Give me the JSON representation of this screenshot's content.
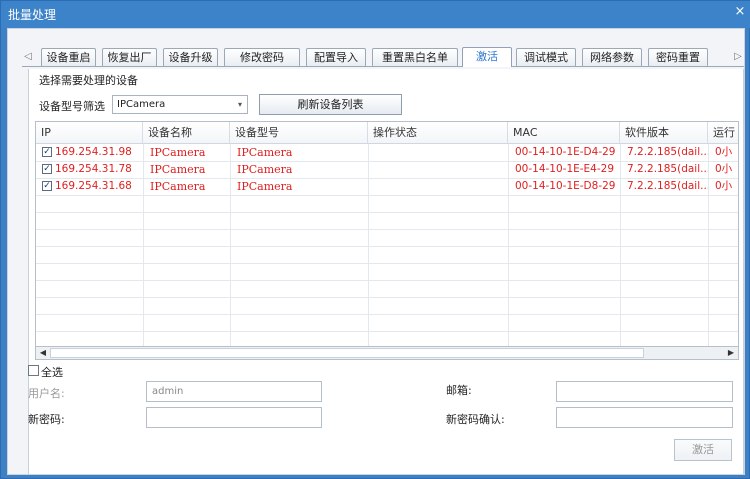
{
  "window": {
    "title": "批量处理",
    "close": "×"
  },
  "tabs": {
    "left_arrow": "◁",
    "right_arrow": "▷",
    "items": [
      {
        "label": "设备重启"
      },
      {
        "label": "恢复出厂"
      },
      {
        "label": "设备升级"
      },
      {
        "label": "修改密码"
      },
      {
        "label": "配置导入"
      },
      {
        "label": "重置黑白名单"
      },
      {
        "label": "激活",
        "active": true
      },
      {
        "label": "调试模式"
      },
      {
        "label": "网络参数"
      },
      {
        "label": "密码重置"
      }
    ]
  },
  "section_title": "选择需要处理的设备",
  "filter": {
    "label": "设备型号筛选",
    "value": "IPCamera",
    "arrow": "▾"
  },
  "refresh_button": "刷新设备列表",
  "grid": {
    "columns": [
      "IP",
      "设备名称",
      "设备型号",
      "操作状态",
      "MAC",
      "软件版本",
      "运行"
    ],
    "rows": [
      {
        "checked": true,
        "ip": "169.254.31.98",
        "name": "IPCamera",
        "model": "IPCamera",
        "status": "",
        "mac": "00-14-10-1E-D4-29",
        "version": "7.2.2.185(dail...",
        "runtime": "0小"
      },
      {
        "checked": true,
        "ip": "169.254.31.78",
        "name": "IPCamera",
        "model": "IPCamera",
        "status": "",
        "mac": "00-14-10-1E-E4-29",
        "version": "7.2.2.185(dail...",
        "runtime": "0小"
      },
      {
        "checked": true,
        "ip": "169.254.31.68",
        "name": "IPCamera",
        "model": "IPCamera",
        "status": "",
        "mac": "00-14-10-1E-D8-29",
        "version": "7.2.2.185(dail...",
        "runtime": "0小"
      }
    ],
    "row_color": "#e02020"
  },
  "scrollbar": {
    "left": "◀",
    "right": "▶"
  },
  "select_all": "全选",
  "form": {
    "username_label": "用户名:",
    "username_value": "admin",
    "email_label": "邮箱:",
    "email_value": "",
    "new_password_label": "新密码:",
    "new_password_value": "",
    "confirm_password_label": "新密码确认:",
    "confirm_password_value": ""
  },
  "activate_button": "激活",
  "colors": {
    "titlebar": "#3d83c9",
    "active_tab": "#2d76d2"
  }
}
